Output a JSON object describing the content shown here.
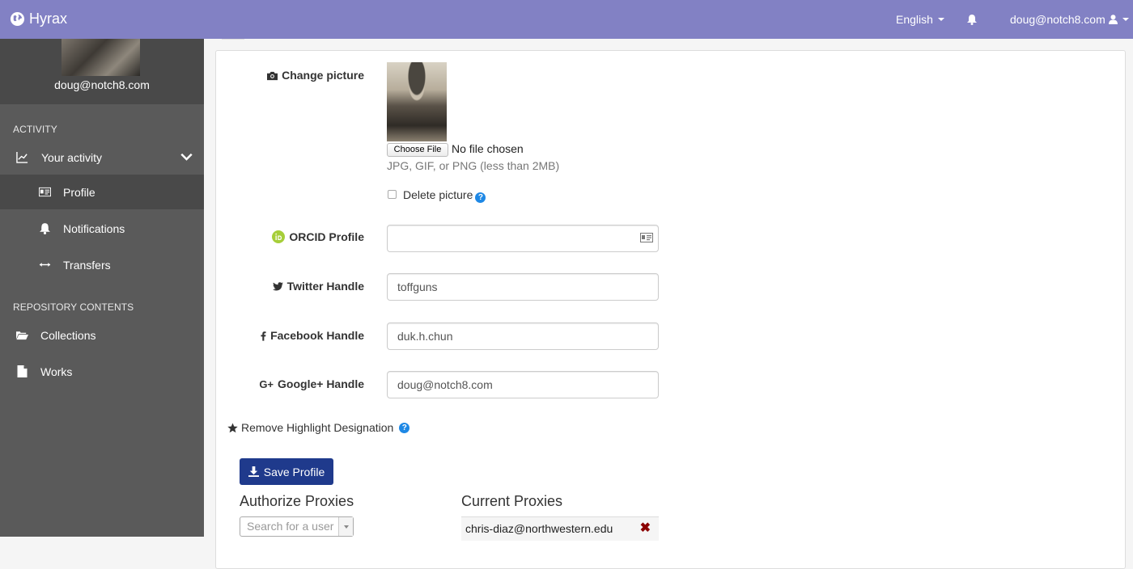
{
  "header": {
    "brand": "Hyrax",
    "language": "English",
    "user": "doug@notch8.com"
  },
  "sidebar": {
    "user_email": "doug@notch8.com",
    "activity_title": "ACTIVITY",
    "your_activity": "Your activity",
    "items": [
      {
        "label": "Profile",
        "icon": "id-card-icon",
        "active": true
      },
      {
        "label": "Notifications",
        "icon": "bell-icon"
      },
      {
        "label": "Transfers",
        "icon": "exchange-icon"
      }
    ],
    "repo_title": "REPOSITORY CONTENTS",
    "repo_items": [
      {
        "label": "Collections",
        "icon": "folder-open-icon"
      },
      {
        "label": "Works",
        "icon": "file-icon"
      }
    ]
  },
  "form": {
    "change_picture_label": "Change picture",
    "choose_file": "Choose File",
    "file_status": "No file chosen",
    "file_help": "JPG, GIF, or PNG (less than 2MB)",
    "delete_picture": "Delete picture",
    "orcid_label": "ORCID Profile",
    "orcid_value": "",
    "twitter_label": "Twitter Handle",
    "twitter_value": "toffguns",
    "facebook_label": "Facebook Handle",
    "facebook_value": "duk.h.chun",
    "google_label": "Google+ Handle",
    "google_value": "doug@notch8.com",
    "google_icon_text": "G+",
    "remove_highlight": "Remove Highlight Designation",
    "help_glyph": "?",
    "save_button": "Save Profile"
  },
  "proxies": {
    "authorize_title": "Authorize Proxies",
    "search_placeholder": "Search for a user",
    "current_title": "Current Proxies",
    "current": [
      {
        "email": "chris-diaz@northwestern.edu",
        "remove_glyph": "✖"
      }
    ]
  },
  "colors": {
    "topbar": "#8281c4",
    "sidebar": "#5a5a5a",
    "save_button": "#1f3a8c",
    "help_icon": "#1e88e5",
    "orcid": "#a6ce39",
    "remove": "#8b0000"
  }
}
